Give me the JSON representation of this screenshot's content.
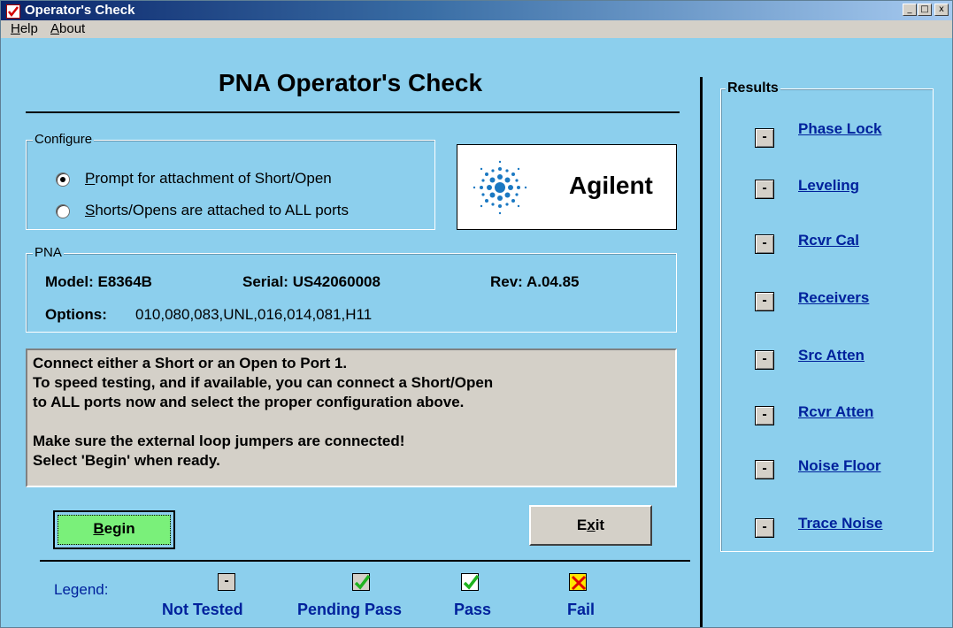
{
  "window": {
    "title": "Operator's Check",
    "controls": {
      "minimize": "_",
      "restore": "□",
      "close": "x"
    }
  },
  "menu": {
    "help": {
      "mnemonic": "H",
      "rest": "elp"
    },
    "about": {
      "mnemonic": "A",
      "rest": "bout"
    }
  },
  "main_title": "PNA Operator's Check",
  "configure": {
    "label": "Configure",
    "options": [
      {
        "mnemonic": "P",
        "rest": "rompt for attachment of Short/Open",
        "selected": true
      },
      {
        "mnemonic": "S",
        "rest": "horts/Opens are attached to ALL ports",
        "selected": false
      }
    ]
  },
  "logo": {
    "text": "Agilent",
    "icon": "agilent-spark-icon",
    "color": "#1a78c2"
  },
  "pna": {
    "label": "PNA",
    "model": "Model: E8364B",
    "serial": "Serial: US42060008",
    "rev": "Rev: A.04.85",
    "options_label": "Options:",
    "options_value": "010,080,083,UNL,016,014,081,H11"
  },
  "message": "Connect either a Short or an Open to Port 1.\nTo speed testing, and if available, you can connect a Short/Open\nto ALL ports now and select the proper configuration above.\n\nMake sure the external loop jumpers are connected!\nSelect 'Begin' when ready.",
  "buttons": {
    "begin": {
      "mnemonic": "B",
      "rest": "egin"
    },
    "exit": {
      "pre": "E",
      "mnemonic": "x",
      "rest": "it"
    }
  },
  "legend": {
    "label": "Legend:",
    "items": [
      {
        "text": "Not Tested",
        "icon": "dash-icon",
        "glyph": "-"
      },
      {
        "text": "Pending Pass",
        "icon": "checkmark-gray-icon"
      },
      {
        "text": "Pass",
        "icon": "checkmark-icon"
      },
      {
        "text": "Fail",
        "icon": "fail-x-icon"
      }
    ]
  },
  "results": {
    "label": "Results",
    "status_glyph": "-",
    "items": [
      "Phase Lock",
      "Leveling",
      "Rcvr Cal",
      "Receivers",
      "Src Atten",
      "Rcvr Atten",
      "Noise Floor",
      "Trace Noise"
    ]
  },
  "colors": {
    "background": "#8ccfed",
    "link_blue": "#00219c",
    "begin_green": "#7af07a",
    "check_green": "#1fb31f",
    "fail_red": "#e00000",
    "fail_yellow": "#ffe600"
  }
}
